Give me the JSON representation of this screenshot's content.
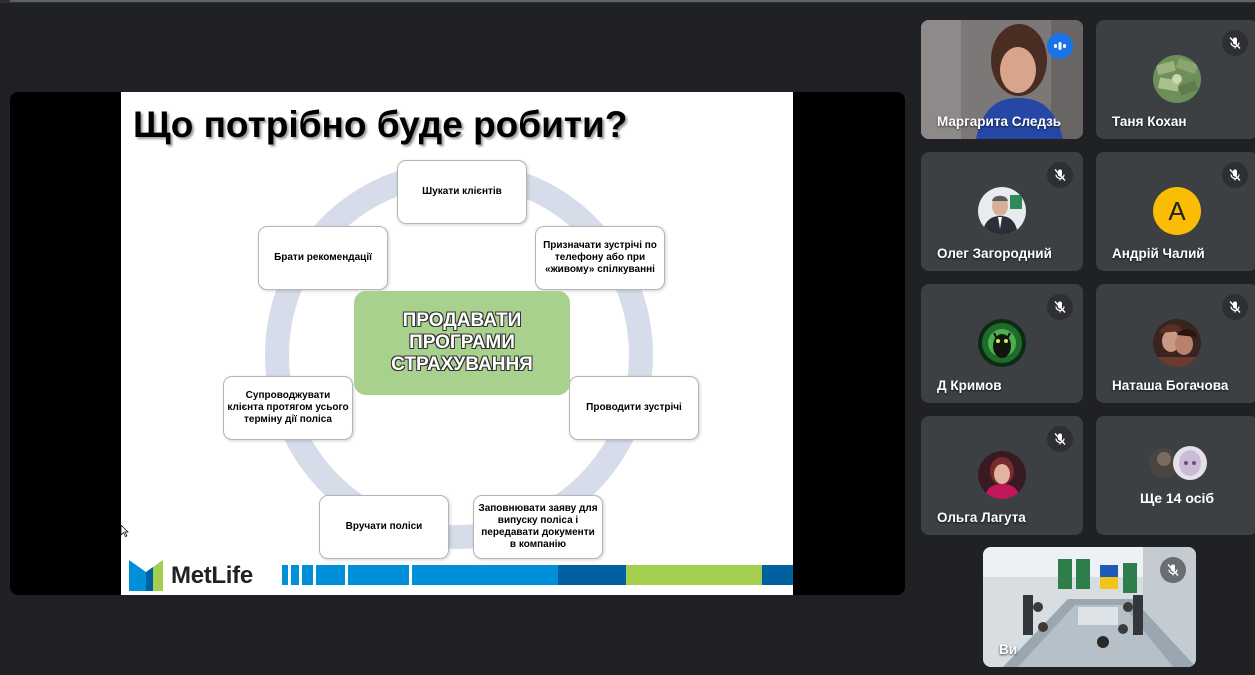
{
  "slide": {
    "title": "Що потрібно буде робити?",
    "center": "ПРОДАВАТИ\nПРОГРАМИ\nСТРАХУВАННЯ",
    "steps": [
      "Шукати клієнтів",
      "Призначати зустрічі по телефону або при «живому» спілкуванні",
      "Проводити зустрічі",
      "Заповнювати заяву для випуску поліса і передавати документи в компанію",
      "Вручати поліси",
      "Супроводжувати клієнта протягом усього терміну дії поліса",
      "Брати рекомендації"
    ],
    "logo_text": "MetLife",
    "colors": {
      "center_fill": "#a9d18e",
      "cycle_arrow": "#d6dce9",
      "brand_blue": "#0090da",
      "brand_dark_blue": "#0061a0",
      "brand_green": "#a4ce4e"
    }
  },
  "participants": [
    {
      "name": "Маргарита Следзь",
      "state": "speaking",
      "icon": "speaking-indicator-icon"
    },
    {
      "name": "Таня Кохан",
      "state": "muted",
      "icon": "mic-off-icon"
    },
    {
      "name": "Олег Загородний",
      "state": "muted",
      "icon": "mic-off-icon"
    },
    {
      "name": "Андрій Чалий",
      "state": "muted",
      "icon": "mic-off-icon",
      "avatar_letter": "A"
    },
    {
      "name": "Д Кримов",
      "state": "muted",
      "icon": "mic-off-icon"
    },
    {
      "name": "Наташа Богачова",
      "state": "muted",
      "icon": "mic-off-icon"
    },
    {
      "name": "Ольга Лагута",
      "state": "muted",
      "icon": "mic-off-icon"
    }
  ],
  "more_participants": {
    "label": "Ще 14 осіб"
  },
  "self_view": {
    "name": "Ви",
    "state": "muted",
    "icon": "mic-off-icon"
  }
}
